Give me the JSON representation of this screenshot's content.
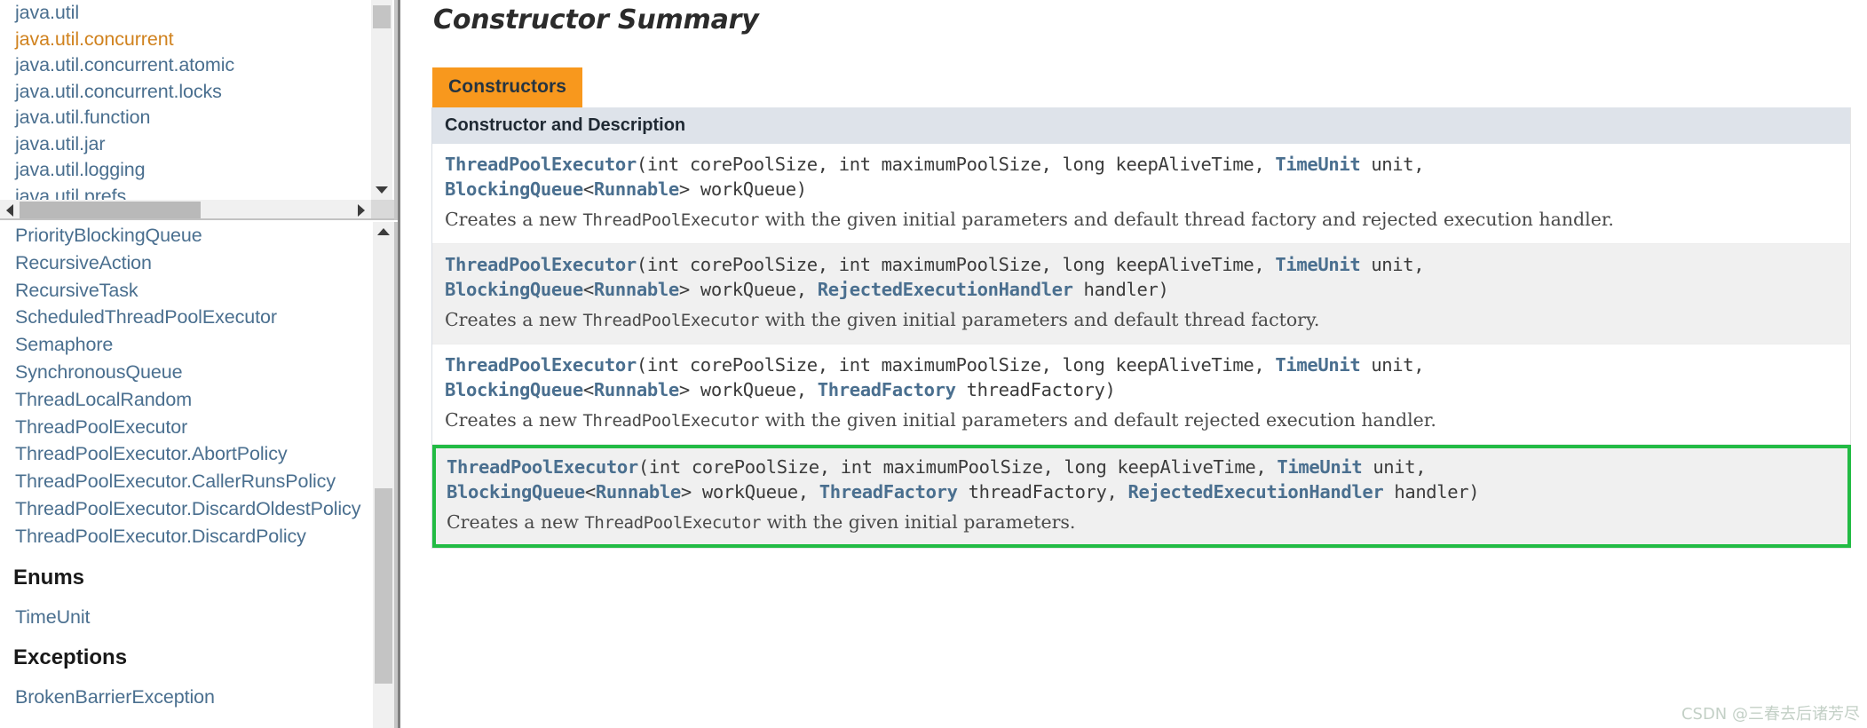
{
  "sidebar": {
    "packages": [
      {
        "name": "java.util",
        "active": false
      },
      {
        "name": "java.util.concurrent",
        "active": true
      },
      {
        "name": "java.util.concurrent.atomic",
        "active": false
      },
      {
        "name": "java.util.concurrent.locks",
        "active": false
      },
      {
        "name": "java.util.function",
        "active": false
      },
      {
        "name": "java.util.jar",
        "active": false
      },
      {
        "name": "java.util.logging",
        "active": false
      },
      {
        "name": "java.util.prefs",
        "active": false
      }
    ],
    "classes": [
      "PriorityBlockingQueue",
      "RecursiveAction",
      "RecursiveTask",
      "ScheduledThreadPoolExecutor",
      "Semaphore",
      "SynchronousQueue",
      "ThreadLocalRandom",
      "ThreadPoolExecutor",
      "ThreadPoolExecutor.AbortPolicy",
      "ThreadPoolExecutor.CallerRunsPolicy",
      "ThreadPoolExecutor.DiscardOldestPolicy",
      "ThreadPoolExecutor.DiscardPolicy"
    ],
    "enums_heading": "Enums",
    "enums": [
      "TimeUnit"
    ],
    "exceptions_heading": "Exceptions",
    "exceptions": [
      "BrokenBarrierException"
    ]
  },
  "main": {
    "title": "Constructor Summary",
    "tab_label": "Constructors",
    "table_header": "Constructor and Description",
    "rows": [
      {
        "sig_line1_name": "ThreadPoolExecutor",
        "sig_line1_rest_a": "(int corePoolSize, int maximumPoolSize, long keepAliveTime, ",
        "sig_line1_type": "TimeUnit",
        "sig_line1_rest_b": " unit,",
        "sig_line2_type1": "BlockingQueue",
        "sig_line2_mid1": "<",
        "sig_line2_type2": "Runnable",
        "sig_line2_mid2": "> workQueue)",
        "sig_line2_type3": "",
        "sig_line2_tail": "",
        "desc_pre": "Creates a new ",
        "desc_code": "ThreadPoolExecutor",
        "desc_post": " with the given initial parameters and default thread factory and rejected execution handler.",
        "style": "plain"
      },
      {
        "sig_line1_name": "ThreadPoolExecutor",
        "sig_line1_rest_a": "(int corePoolSize, int maximumPoolSize, long keepAliveTime, ",
        "sig_line1_type": "TimeUnit",
        "sig_line1_rest_b": " unit,",
        "sig_line2_type1": "BlockingQueue",
        "sig_line2_mid1": "<",
        "sig_line2_type2": "Runnable",
        "sig_line2_mid2": "> workQueue, ",
        "sig_line2_type3": "RejectedExecutionHandler",
        "sig_line2_tail": " handler)",
        "desc_pre": "Creates a new ",
        "desc_code": "ThreadPoolExecutor",
        "desc_post": " with the given initial parameters and default thread factory.",
        "style": "alt"
      },
      {
        "sig_line1_name": "ThreadPoolExecutor",
        "sig_line1_rest_a": "(int corePoolSize, int maximumPoolSize, long keepAliveTime, ",
        "sig_line1_type": "TimeUnit",
        "sig_line1_rest_b": " unit,",
        "sig_line2_type1": "BlockingQueue",
        "sig_line2_mid1": "<",
        "sig_line2_type2": "Runnable",
        "sig_line2_mid2": "> workQueue, ",
        "sig_line2_type3": "ThreadFactory",
        "sig_line2_tail": " threadFactory)",
        "desc_pre": "Creates a new ",
        "desc_code": "ThreadPoolExecutor",
        "desc_post": " with the given initial parameters and default rejected execution handler.",
        "style": "plain"
      },
      {
        "sig_line1_name": "ThreadPoolExecutor",
        "sig_line1_rest_a": "(int corePoolSize, int maximumPoolSize, long keepAliveTime, ",
        "sig_line1_type": "TimeUnit",
        "sig_line1_rest_b": " unit,",
        "sig_line2_type1": "BlockingQueue",
        "sig_line2_mid1": "<",
        "sig_line2_type2": "Runnable",
        "sig_line2_mid2": "> workQueue, ",
        "sig_line2_type3": "ThreadFactory",
        "sig_line2_tail": " threadFactory, ",
        "sig_line2_type4": "RejectedExecutionHandler",
        "sig_line2_tail2": " handler)",
        "desc_pre": "Creates a new ",
        "desc_code": "ThreadPoolExecutor",
        "desc_post": " with the given initial parameters.",
        "style": "hl"
      }
    ]
  },
  "watermark": "CSDN @三春去后诸芳尽",
  "colors": {
    "tab_orange": "#f8981d",
    "table_header_bg": "#dee3ea",
    "link_blue": "#4a6f8f",
    "active_orange": "#d0821e",
    "highlight_green": "#22bb44",
    "alt_row_bg": "#f0f0f0"
  }
}
